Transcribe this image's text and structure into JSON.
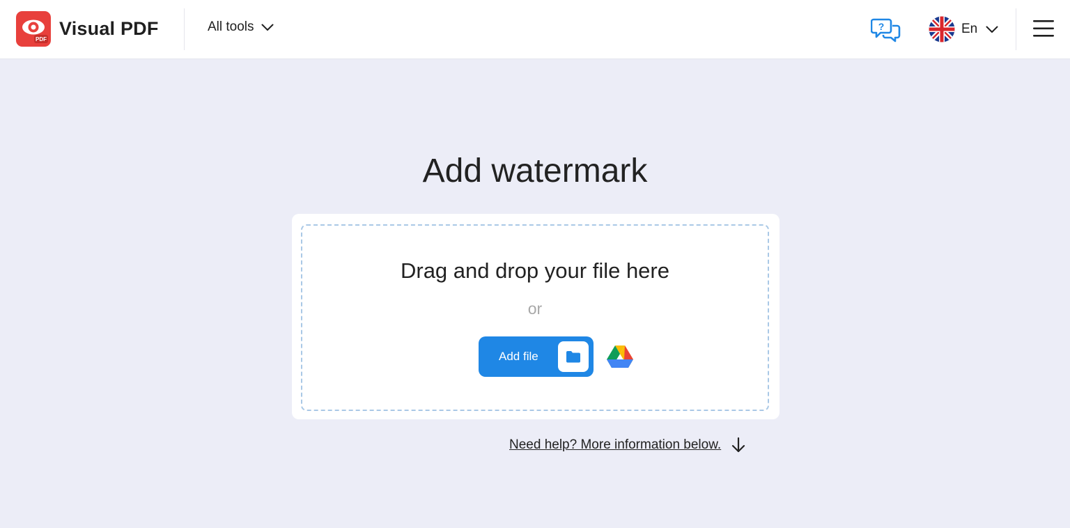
{
  "header": {
    "logo_text": "Visual PDF",
    "logo_badge_text": "PDF",
    "all_tools_label": "All tools",
    "language_code": "En"
  },
  "main": {
    "title": "Add watermark",
    "drop_text": "Drag and drop your file here",
    "or_text": "or",
    "add_file_label": "Add file",
    "help_link": "Need help? More information below."
  },
  "colors": {
    "brand_red": "#e8403c",
    "primary_blue": "#1f87e5",
    "page_bg": "#ecedf7"
  },
  "icons": [
    "logo-eye-icon",
    "chevron-down-icon",
    "help-chat-icon",
    "uk-flag-icon",
    "hamburger-menu-icon",
    "folder-icon",
    "google-drive-icon",
    "arrow-down-icon"
  ]
}
